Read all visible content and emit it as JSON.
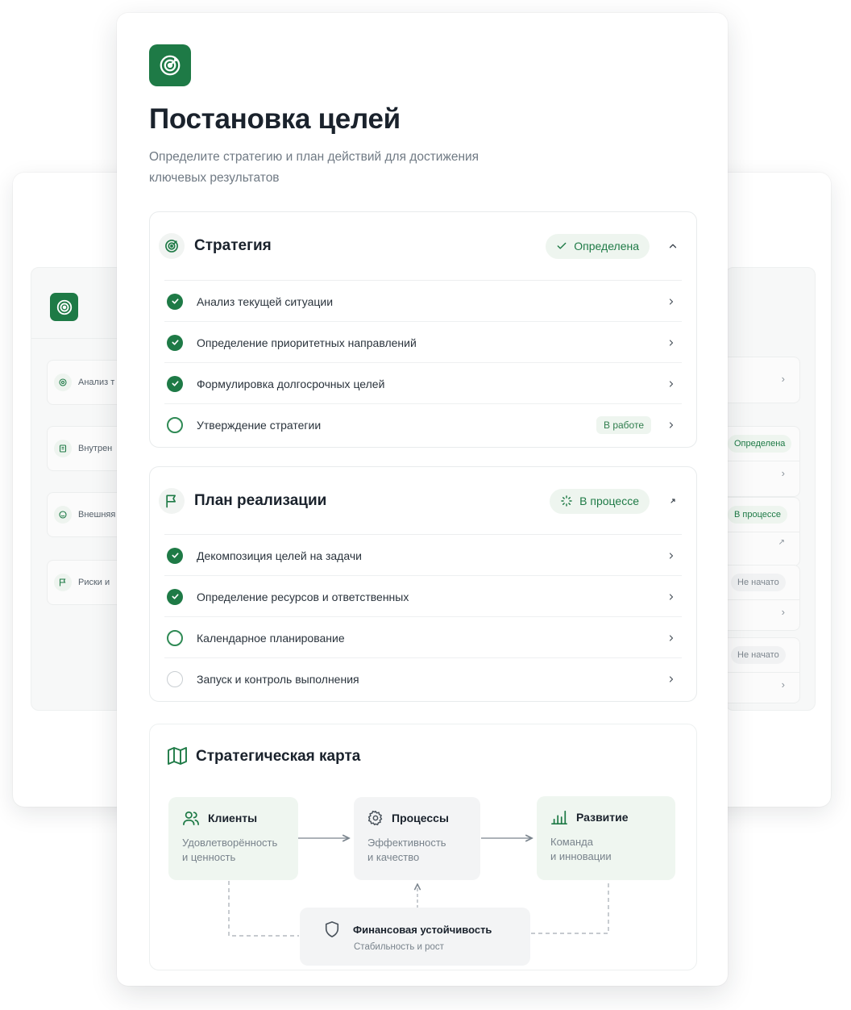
{
  "colors": {
    "accent": "#1e7a46",
    "accent_light": "#eef5ef",
    "text": "#1a222c",
    "muted": "#707a84"
  },
  "background_card": {
    "left_items": [
      {
        "icon": "analysis-icon",
        "label": "Анализ т"
      },
      {
        "icon": "building-icon",
        "label": "Внутрен"
      },
      {
        "icon": "globe-icon",
        "label": "Внешняя"
      },
      {
        "icon": "flag-icon",
        "label": "Риски и"
      }
    ],
    "right_badges": [
      "Определена",
      "В процессе",
      "Не начато",
      "Не начато"
    ]
  },
  "header": {
    "logo_icon": "target-icon",
    "title": "Постановка целей",
    "subtitle": "Определите стратегию и план действий для достижения ключевых результатов"
  },
  "sections": [
    {
      "icon": "target-icon",
      "title": "Стратегия",
      "status": "Определена",
      "status_icon": "check-icon",
      "items": [
        {
          "label": "Анализ текущей ситуации",
          "state": "done"
        },
        {
          "label": "Определение приоритетных направлений",
          "state": "done"
        },
        {
          "label": "Формулировка долгосрочных целей",
          "state": "done"
        },
        {
          "label": "Утверждение стратегии",
          "state": "todo",
          "badge": "В работе"
        }
      ]
    },
    {
      "icon": "flag-icon",
      "title": "План реализации",
      "status": "В процессе",
      "status_icon": "loader-icon",
      "items": [
        {
          "label": "Декомпозиция целей на задачи",
          "state": "done"
        },
        {
          "label": "Определение ресурсов и ответственных",
          "state": "done"
        },
        {
          "label": "Календарное планирование",
          "state": "todo"
        },
        {
          "label": "Запуск и контроль выполнения",
          "state": "idle"
        }
      ]
    }
  ],
  "strategy_map": {
    "icon": "map-icon",
    "title": "Стратегическая карта",
    "nodes": {
      "clients": {
        "icon": "users-icon",
        "title": "Клиенты",
        "subtitle_1": "Удовлетворённость",
        "subtitle_2": "и ценность"
      },
      "processes": {
        "icon": "gear-icon",
        "title": "Процессы",
        "subtitle_1": "Эффективность",
        "subtitle_2": "и качество"
      },
      "growth": {
        "icon": "bar-chart-icon",
        "title": "Развитие",
        "subtitle_1": "Команда",
        "subtitle_2": "и инновации"
      },
      "finance": {
        "icon": "shield-icon",
        "title": "Финансовая устойчивость",
        "subtitle": "Стабильность и рост"
      }
    }
  }
}
